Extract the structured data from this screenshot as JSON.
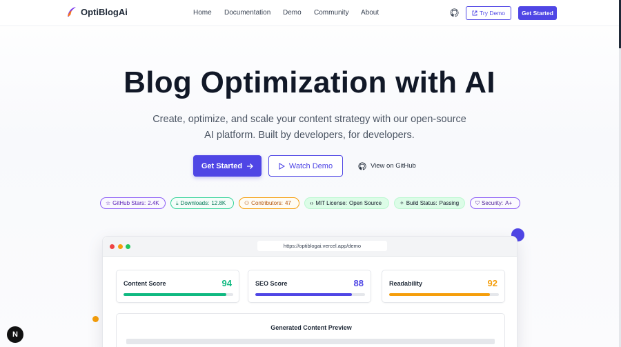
{
  "brand": {
    "name": "OptiBlogAi"
  },
  "nav": {
    "links": [
      "Home",
      "Documentation",
      "Demo",
      "Community",
      "About"
    ],
    "try_demo": "Try Demo",
    "get_started": "Get Started"
  },
  "hero": {
    "title": "Blog Optimization with AI",
    "subtitle": "Create, optimize, and scale your content strategy with our open-source AI platform. Built by developers, for developers.",
    "primary_button": "Get Started",
    "secondary_button": "Watch Demo",
    "link_button": "View on GitHub"
  },
  "badges": [
    {
      "label": "GitHub Stars:",
      "value": "2.4K"
    },
    {
      "label": "Downloads:",
      "value": "12.8K"
    },
    {
      "label": "Contributors:",
      "value": "47"
    },
    {
      "label": "MIT License:",
      "value": "Open Source"
    },
    {
      "label": "Build Status:",
      "value": "Passing"
    },
    {
      "label": "Security:",
      "value": "A+"
    }
  ],
  "demo": {
    "url": "https://optiblogai.vercel.app/demo",
    "scores": [
      {
        "label": "Content Score",
        "value": 94,
        "color": "#10b981"
      },
      {
        "label": "SEO Score",
        "value": 88,
        "color": "#4f46e5"
      },
      {
        "label": "Readability",
        "value": 92,
        "color": "#f59e0b"
      }
    ],
    "preview_title": "Generated Content Preview"
  },
  "colors": {
    "accent": "#4f46e5"
  },
  "dev_badge": "N"
}
